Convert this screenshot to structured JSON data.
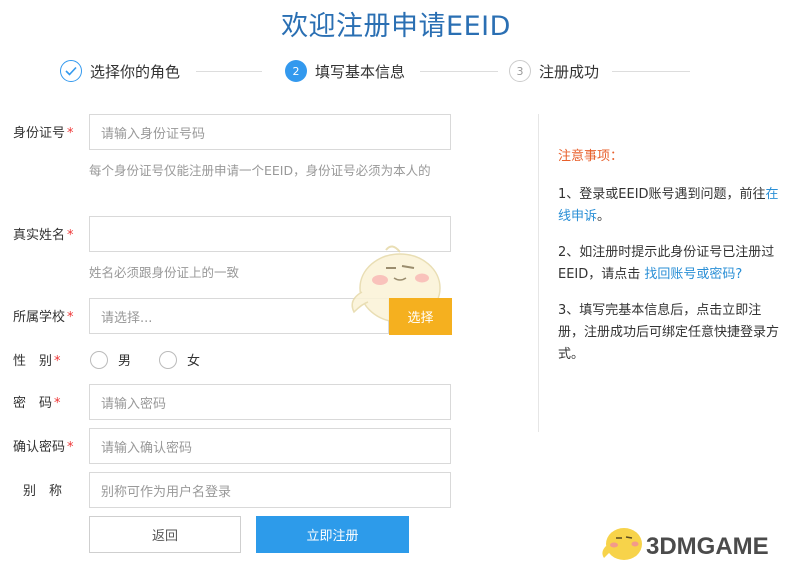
{
  "page": {
    "title": "欢迎注册申请EEID"
  },
  "steps": [
    {
      "index": "✓",
      "label": "选择你的角色",
      "state": "done"
    },
    {
      "index": "2",
      "label": "填写基本信息",
      "state": "active"
    },
    {
      "index": "3",
      "label": "注册成功",
      "state": "todo"
    }
  ],
  "form": {
    "id_card": {
      "label": "身份证号",
      "required": "*",
      "placeholder": "请输入身份证号码",
      "hint": "每个身份证号仅能注册申请一个EEID，身份证号必须为本人的"
    },
    "real_name": {
      "label": "真实姓名",
      "required": "*",
      "placeholder": "",
      "hint": "姓名必须跟身份证上的一致"
    },
    "school": {
      "label": "所属学校",
      "required": "*",
      "placeholder": "请选择...",
      "button": "选择"
    },
    "gender": {
      "label": "性　别",
      "required": "*",
      "options": [
        "男",
        "女"
      ]
    },
    "password": {
      "label": "密　码",
      "required": "*",
      "placeholder": "请输入密码"
    },
    "confirm_password": {
      "label": "确认密码",
      "required": "*",
      "placeholder": "请输入确认密码"
    },
    "nickname": {
      "label": "别　称",
      "placeholder": "别称可作为用户名登录"
    },
    "back_button": "返回",
    "submit_button": "立即注册"
  },
  "notes": {
    "title": "注意事项：",
    "item1_text": "1、登录或EEID账号遇到问题，前往",
    "item1_link": "在线申诉",
    "item1_end": "。",
    "item2_text": "2、如注册时提示此身份证号已注册过EEID，请点击 ",
    "item2_link": "找回账号或密码?",
    "item3_text": "3、填写完基本信息后，点击立即注册，注册成功后可绑定任意快捷登录方式。"
  },
  "watermark": {
    "text": "3DMGAME"
  },
  "colors": {
    "accent": "#3399ee",
    "title": "#2a6fb3",
    "select_button": "#f5b01f",
    "submit_button": "#2d9bea",
    "notes_title": "#e8602c",
    "required": "#ee3333"
  }
}
